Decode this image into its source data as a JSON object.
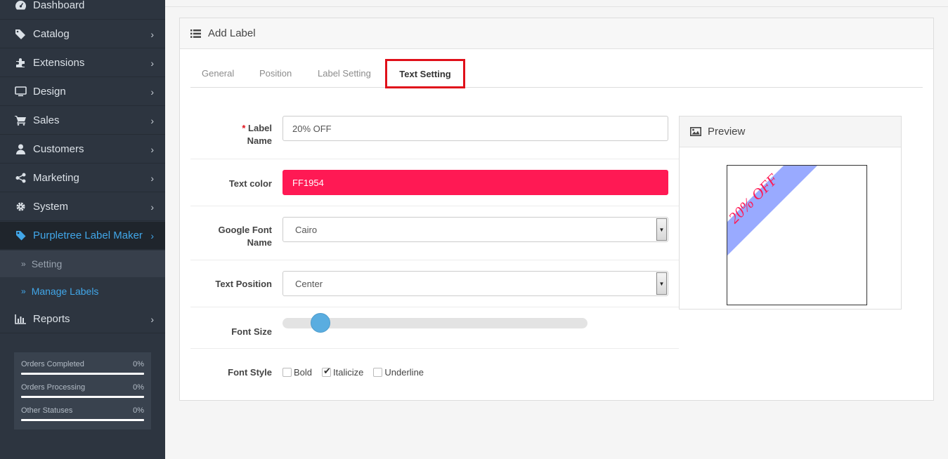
{
  "sidebar": {
    "items": [
      {
        "label": "Dashboard",
        "icon": "dashboard-icon"
      },
      {
        "label": "Catalog",
        "icon": "tags-icon"
      },
      {
        "label": "Extensions",
        "icon": "puzzle-icon"
      },
      {
        "label": "Design",
        "icon": "monitor-icon"
      },
      {
        "label": "Sales",
        "icon": "cart-icon"
      },
      {
        "label": "Customers",
        "icon": "user-icon"
      },
      {
        "label": "Marketing",
        "icon": "share-icon"
      },
      {
        "label": "System",
        "icon": "gear-icon"
      },
      {
        "label": "Purpletree Label Maker",
        "icon": "tag-icon"
      },
      {
        "label": "Reports",
        "icon": "bar-chart-icon"
      }
    ],
    "subitems": [
      {
        "label": "Setting"
      },
      {
        "label": "Manage Labels"
      }
    ],
    "stats": [
      {
        "label": "Orders Completed",
        "value": "0%"
      },
      {
        "label": "Orders Processing",
        "value": "0%"
      },
      {
        "label": "Other Statuses",
        "value": "0%"
      }
    ]
  },
  "panel": {
    "title": "Add Label",
    "tabs": [
      "General",
      "Position",
      "Label Setting",
      "Text Setting"
    ],
    "form": {
      "label_name": {
        "label_line1": "Label",
        "label_line2": "Name",
        "required_mark": "*",
        "value": "20%  OFF"
      },
      "text_color": {
        "label": "Text color",
        "value": "FF1954",
        "color": "#ff1954"
      },
      "google_font": {
        "label_line1": "Google Font",
        "label_line2": "Name",
        "value": "Cairo"
      },
      "text_position": {
        "label": "Text Position",
        "value": "Center"
      },
      "font_size": {
        "label": "Font Size",
        "level": 0.12
      },
      "font_style": {
        "label": "Font Style",
        "options": [
          {
            "label": "Bold",
            "checked": false
          },
          {
            "label": "Italicize",
            "checked": true
          },
          {
            "label": "Underline",
            "checked": false
          }
        ]
      }
    },
    "preview": {
      "title": "Preview",
      "label_text": "20% OFF",
      "ribbon_color": "#99aaff",
      "text_color": "#ff1954"
    }
  }
}
